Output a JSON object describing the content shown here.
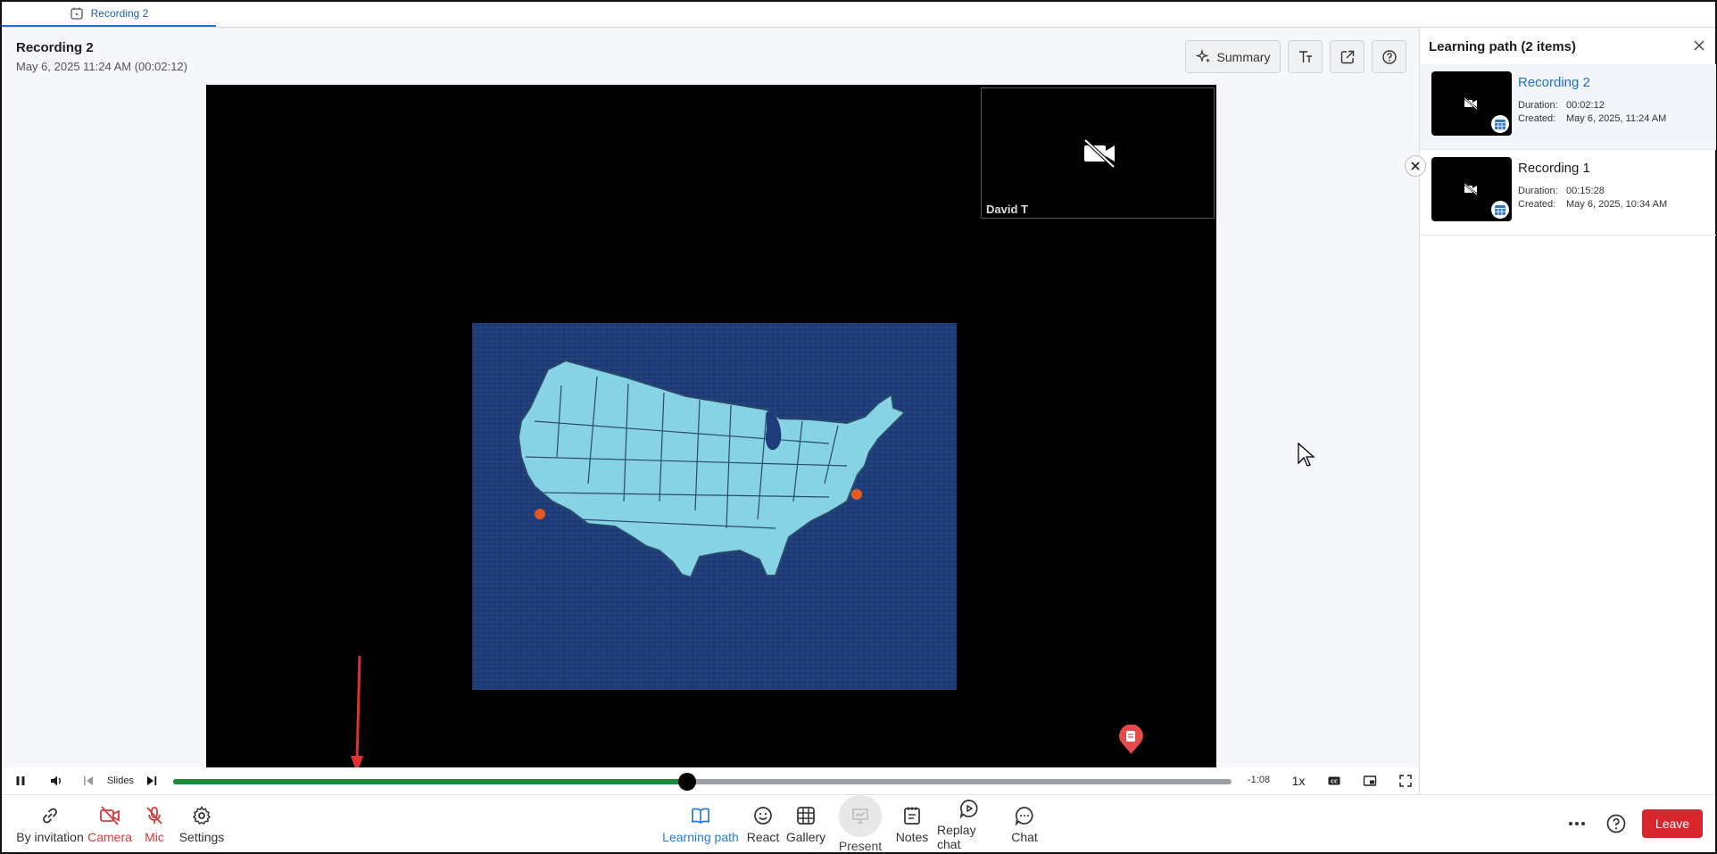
{
  "tab": {
    "label": "Recording 2"
  },
  "recording": {
    "title": "Recording 2",
    "subtitle": "May 6, 2025 11:24 AM (00:02:12)"
  },
  "top_actions": {
    "summary_label": "Summary"
  },
  "camera_tile": {
    "name": "David T"
  },
  "player": {
    "slides_label": "Slides",
    "time_remaining": "-1:08",
    "speed": "1x",
    "played_fraction": 0.486,
    "buffered_fraction": 0.486,
    "marker_fraction": 0.907
  },
  "toolbar": {
    "by_invitation": "By invitation",
    "camera": "Camera",
    "mic": "Mic",
    "settings": "Settings",
    "learning_path": "Learning path",
    "react": "React",
    "gallery": "Gallery",
    "present": "Present",
    "notes": "Notes",
    "replay_chat": "Replay chat",
    "chat": "Chat",
    "leave": "Leave"
  },
  "sidebar": {
    "title": "Learning path (2 items)",
    "duration_key": "Duration:",
    "created_key": "Created:",
    "items": [
      {
        "name": "Recording 2",
        "duration": "00:02:12",
        "created": "May 6, 2025, 11:24 AM",
        "active": true
      },
      {
        "name": "Recording 1",
        "duration": "00:15:28",
        "created": "May 6, 2025, 10:34 AM",
        "active": false
      }
    ]
  },
  "colors": {
    "accent": "#1f6fd1",
    "played": "#1b8a3a",
    "leave": "#d8262e",
    "muted_red": "#d23b3b",
    "slide_bg": "#1e3b7a",
    "map_fill": "#86d3e6"
  }
}
